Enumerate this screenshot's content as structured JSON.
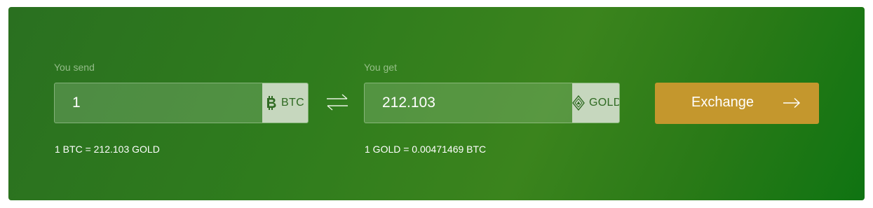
{
  "send": {
    "label": "You send",
    "amount": "1",
    "currency": "BTC",
    "currency_icon": "bitcoin-icon",
    "rate": "1 BTC = 212.103 GOLD"
  },
  "get": {
    "label": "You get",
    "amount": "212.103",
    "currency": "GOLD",
    "currency_icon": "gold-token-icon",
    "rate": "1 GOLD = 0.00471469 BTC"
  },
  "swap_icon": "swap-arrows-icon",
  "exchange_button": {
    "label": "Exchange",
    "icon": "arrow-right-icon"
  },
  "colors": {
    "panel_green": "#2f7c1d",
    "currency_chip": "#c6d7be",
    "currency_text": "#2f6a22",
    "button_gold": "#c4972d"
  }
}
